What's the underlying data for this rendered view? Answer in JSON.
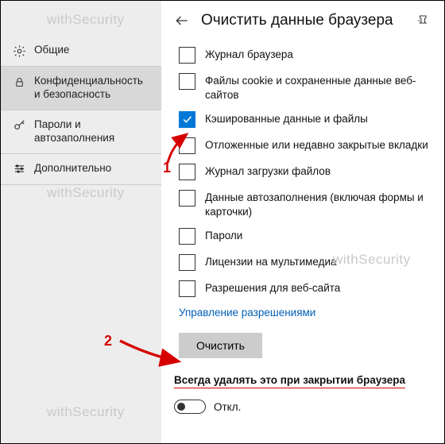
{
  "sidebar": {
    "items": [
      {
        "label": "Общие",
        "icon": "gear-icon"
      },
      {
        "label": "Конфиденциальность и безопасность",
        "icon": "lock-icon"
      },
      {
        "label": "Пароли и автозаполнения",
        "icon": "key-icon"
      },
      {
        "label": "Дополнительно",
        "icon": "sliders-icon"
      }
    ]
  },
  "panel": {
    "title": "Очистить данные браузера",
    "checkItems": [
      {
        "label": "Журнал браузера",
        "checked": false
      },
      {
        "label": "Файлы cookie и сохраненные данные веб-сайтов",
        "checked": false
      },
      {
        "label": "Кэшированные данные и файлы",
        "checked": true
      },
      {
        "label": "Отложенные или недавно закрытые вкладки",
        "checked": false
      },
      {
        "label": "Журнал загрузки файлов",
        "checked": false
      },
      {
        "label": "Данные автозаполнения (включая формы и карточки)",
        "checked": false
      },
      {
        "label": "Пароли",
        "checked": false
      },
      {
        "label": "Лицензии на мультимедиа",
        "checked": false
      },
      {
        "label": "Разрешения для веб-сайта",
        "checked": false
      }
    ],
    "permissionsLink": "Управление разрешениями",
    "clearButton": "Очистить",
    "alwaysLabel": "Всегда удалять это при закрытии браузера",
    "toggleLabel": "Откл."
  },
  "annotations": {
    "one": "1",
    "two": "2"
  },
  "watermark": "withSecurity"
}
